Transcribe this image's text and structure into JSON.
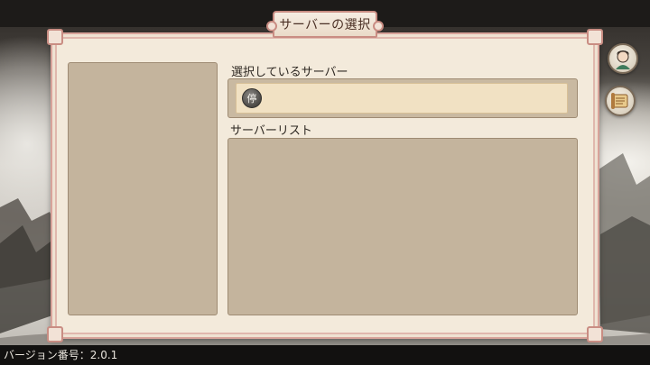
{
  "dialog": {
    "title": "サーバーの選択"
  },
  "selected_server": {
    "label": "選択しているサーバー",
    "status_badge": "停"
  },
  "server_list": {
    "label": "サーバーリスト"
  },
  "side_buttons": [
    {
      "icon": "character-avatar-icon"
    },
    {
      "icon": "announcement-scroll-icon"
    }
  ],
  "footer": {
    "version_text": "バージョン番号：2.0.1"
  },
  "colors": {
    "panel_bg": "#f3eadb",
    "panel_border": "#d8a39a",
    "well_bg": "#c4b49d",
    "selected_field_bg": "#f1e1c3",
    "title_text": "#4a2f24"
  }
}
